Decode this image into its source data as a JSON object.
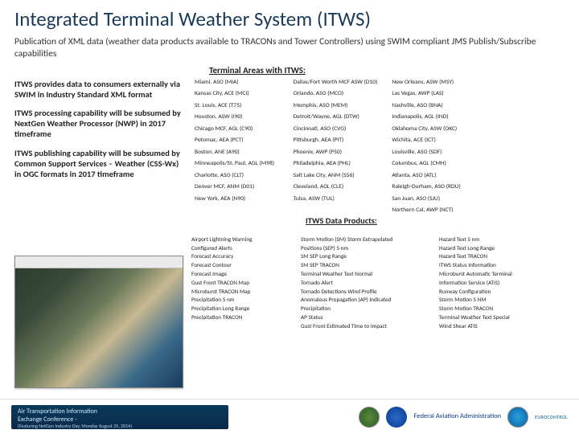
{
  "title": "Integrated Terminal Weather System (ITWS)",
  "subtitle": "Publication of XML data (weather data products available to TRACONs and Tower Controllers) using SWIM compliant JMS Publish/Subscribe capabilities",
  "terminal_header": "Terminal Areas with ITWS:",
  "bullets": {
    "b1": "ITWS provides data to consumers externally via SWIM in Industry Standard XML format",
    "b2": "ITWS processing capability will be subsumed by NextGen Weather Processor (NWP) in 2017 timeframe",
    "b3": "ITWS publishing capability will be subsumed by Common Support Services – Weather (CSS-Wx) in OGC formats in 2017 timeframe"
  },
  "terminals": [
    "Miami, ASO (MIA)",
    "Dallas/Fort Worth MCF ASW (D10)",
    "New Orleans, ASW (MSY)",
    "Kansas City, ACE (MCI)",
    "Orlando, ASO (MCO)",
    "Las Vegas, AWP (LAS)",
    "St. Louis, ACE (T75)",
    "Memphis, ASO (MEM)",
    "Nashville, ASO (BNA)",
    "Houston, ASW (I90)",
    "Detroit/Wayne, AGL (DTW)",
    "Indianapolis, AGL (IND)",
    "Chicago MCF, AGL (C90)",
    "Cincinnati, ASO (CVG)",
    "Oklahoma City, ASW (OKC)",
    "Potomac, AEA (PCT)",
    "Pittsburgh, AEA (PIT)",
    "Wichita, ACE (ICT)",
    "Boston, ANE (A90)",
    "Phoenix, AWP (P50)",
    "Louisville, ASO (SDF)",
    "Minneapolis/St. Paul, AGL (M98)",
    "Philadelphia, AEA (PHL)",
    "Columbus, AGL (CMH)",
    "Charlotte, ASO (CLT)",
    "Salt Lake City, ANM (S56)",
    "Atlanta, ASO (ATL)",
    "Denver MCF, ANM (D01)",
    "Cleveland, AGL (CLE)",
    "Raleigh-Durham, ASO (RDU)",
    "New York, AEA (N90)",
    "Tulsa, ASW (TUL)",
    "San Juan, ASO (SJU)",
    "",
    "",
    "Northern Cal, AWP (NCT)"
  ],
  "data_products_header": "ITWS Data Products:",
  "products": {
    "c1": [
      "Airport Lightning Warning",
      "Configured Alerts",
      "Forecast Accuracy",
      "Forecast Contour",
      "Forecast Image",
      "Gust Front TRACON Map",
      "Microburst TRACON Map",
      "Precipitation 5 nm",
      "Precipitation Long Range",
      "Precipitation TRACON"
    ],
    "c2": [
      "Storm Motion (SM) Storm Extrapolated",
      "Positions (SEP) 5 nm",
      "SM SEP Long Range",
      "SM SEP TRACON",
      "Terminal Weather Text Normal",
      "Tornado Alert",
      "Tornado Detections Wind Profile",
      "Anomalous Propagation (AP) Indicated",
      "Precipitation",
      "AP Status",
      "Gust Front Estimated Time to Impact"
    ],
    "c3": [
      "Hazard Text 5 nm",
      "Hazard Text Long Range",
      "Hazard Text TRACON",
      "ITWS Status Information",
      "Microburst Automatic Terminal",
      "Information Service (ATIS)",
      "Runway Configuration",
      "Storm Motion 5 NM",
      "Storm Motion TRACON",
      "Terminal Weather Text Special",
      "Wind Shear ATIS"
    ]
  },
  "footer": {
    "banner_l1": "Air Transportation Information",
    "banner_l2": "Exchange Conference -",
    "banner_l3": "(Featuring NetGen Industry Day, Monday August 25, 2014)",
    "faa": "Federal Aviation Administration",
    "eurocontrol": "EUROCONTROL"
  }
}
